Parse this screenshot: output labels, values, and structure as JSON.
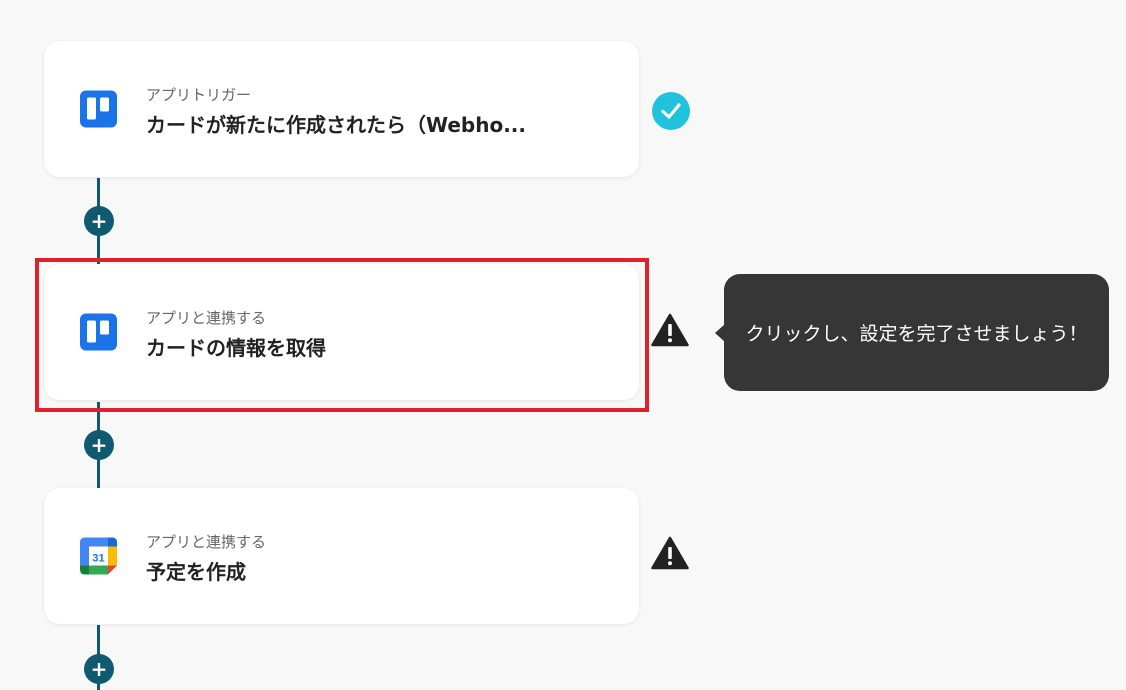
{
  "steps": [
    {
      "subtitle": "アプリトリガー",
      "title": "カードが新たに作成されたら（Webho...",
      "app_icon": "trello-icon",
      "status": "complete"
    },
    {
      "subtitle": "アプリと連携する",
      "title": "カードの情報を取得",
      "app_icon": "trello-icon",
      "status": "warning"
    },
    {
      "subtitle": "アプリと連携する",
      "title": "予定を作成",
      "app_icon": "google-calendar-icon",
      "status": "warning",
      "calendar_day": "31"
    }
  ],
  "tooltip": {
    "text": "クリックし、設定を完了させましょう！"
  },
  "add_button": {
    "label": "+"
  },
  "colors": {
    "connector": "#0f5a70",
    "trello": "#1a73e8",
    "check": "#21c3dc",
    "highlight": "#e0202a",
    "tooltip_bg": "#363636"
  }
}
